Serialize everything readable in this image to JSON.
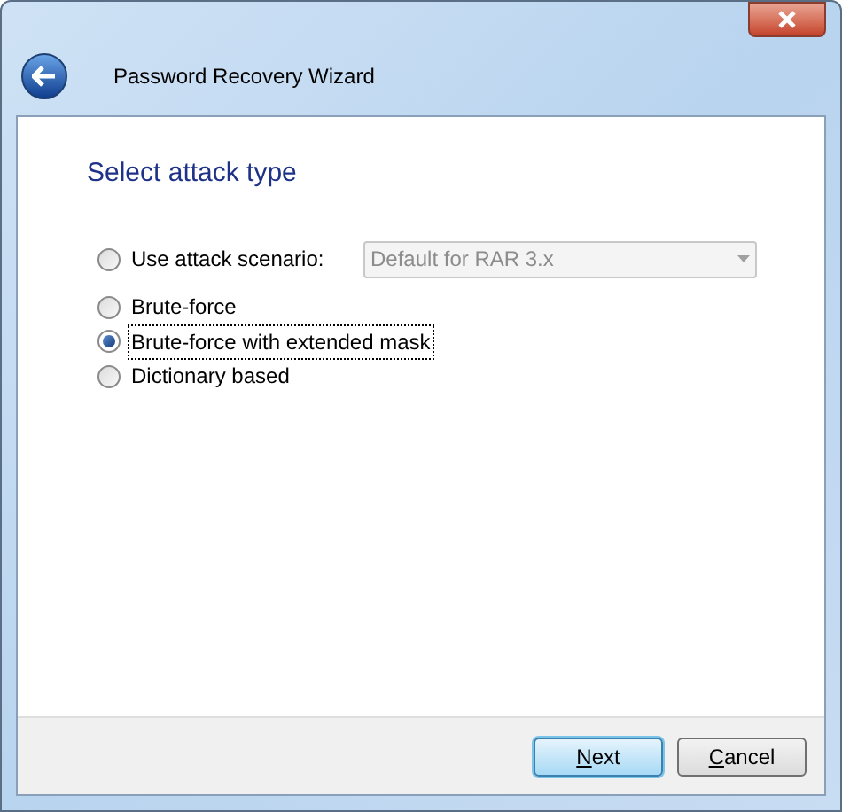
{
  "window": {
    "title": "Password Recovery Wizard"
  },
  "heading": "Select attack type",
  "options": [
    {
      "label": "Use attack scenario:",
      "selected": false,
      "kind": "scenario",
      "dropdown": {
        "value": "Default for RAR 3.x",
        "disabled": true
      }
    },
    {
      "label": "Brute-force",
      "selected": false,
      "kind": "plain"
    },
    {
      "label": "Brute-force with extended mask",
      "selected": true,
      "kind": "plain"
    },
    {
      "label": "Dictionary based",
      "selected": false,
      "kind": "plain"
    }
  ],
  "buttons": [
    {
      "label": "Next",
      "kind": "default"
    },
    {
      "label": "Cancel",
      "kind": "normal"
    }
  ]
}
